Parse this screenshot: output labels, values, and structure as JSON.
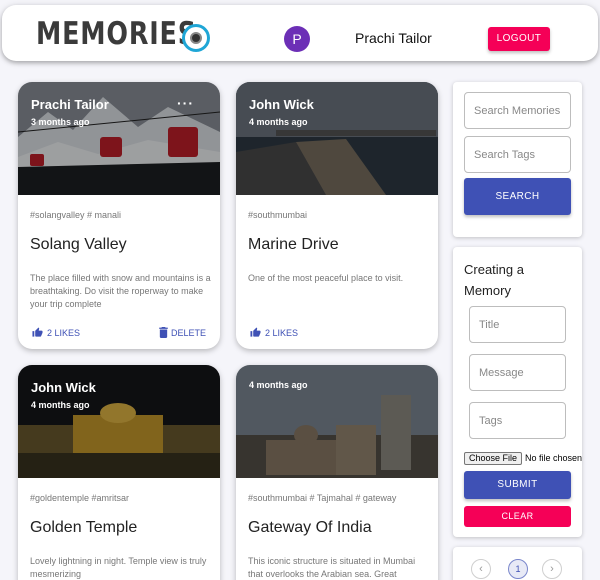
{
  "header": {
    "brand": "MEMORIES",
    "avatar_letter": "P",
    "username": "Prachi Tailor",
    "logout_label": "LOGOUT",
    "colors": {
      "logout": "#f50057",
      "avatar": "#6c2fb6",
      "brand": "#3b3b3b"
    }
  },
  "posts": [
    {
      "creator": "Prachi Tailor",
      "time": "3 months ago",
      "more_icon": "···",
      "tags": "#solangvalley # manali",
      "title": "Solang Valley",
      "message": "The place filled with snow and mountains is a breathtaking. Do visit the roperway to make your trip complete",
      "likes": "2 LIKES",
      "delete": "DELETE"
    },
    {
      "creator": "John Wick",
      "time": "4 months ago",
      "tags": "#southmumbai",
      "title": "Marine Drive",
      "message": "One of the most peaceful place to visit.",
      "likes": "2 LIKES"
    },
    {
      "creator": "John Wick",
      "time": "4 months ago",
      "tags": "#goldentemple #amritsar",
      "title": "Golden Temple",
      "message": "Lovely lightning in night. Temple view is truly mesmerizing"
    },
    {
      "creator": "",
      "time": "4 months ago",
      "tags": "#southmumbai # Tajmahal # gateway",
      "title": "Gateway Of India",
      "message": "This iconic structure is situated in Mumbai that overlooks the Arabian sea. Great"
    }
  ],
  "search": {
    "memories_placeholder": "Search Memories",
    "tags_placeholder": "Search Tags",
    "button_label": "SEARCH"
  },
  "form": {
    "heading": "Creating a Memory",
    "title_placeholder": "Title",
    "message_placeholder": "Message",
    "tags_placeholder": "Tags",
    "file_button": "Choose File",
    "file_status": "No file chosen",
    "submit_label": "SUBMIT",
    "clear_label": "CLEAR"
  },
  "pagination": {
    "prev": "‹",
    "page": "1",
    "next": "›"
  }
}
